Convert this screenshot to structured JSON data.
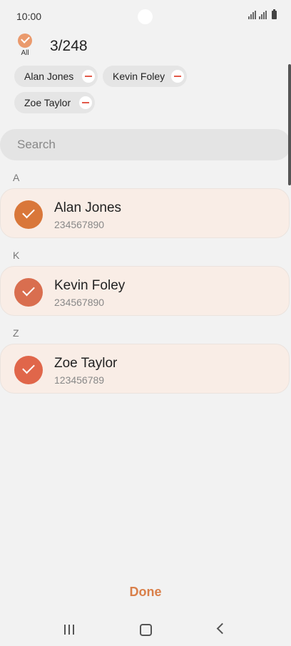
{
  "status_bar": {
    "time": "10:00"
  },
  "header": {
    "all_label": "All",
    "selection_count": "3/248"
  },
  "selected_chips": [
    {
      "label": "Alan Jones"
    },
    {
      "label": "Kevin Foley"
    },
    {
      "label": "Zoe Taylor"
    }
  ],
  "search": {
    "placeholder": "Search"
  },
  "sections": [
    {
      "letter": "A",
      "contact": {
        "name": "Alan Jones",
        "number": "234567890",
        "color": "#d9773a"
      }
    },
    {
      "letter": "K",
      "contact": {
        "name": "Kevin Foley",
        "number": "234567890",
        "color": "#d96e4f"
      }
    },
    {
      "letter": "Z",
      "contact": {
        "name": "Zoe Taylor",
        "number": "123456789",
        "color": "#e0664a"
      }
    }
  ],
  "footer": {
    "done_label": "Done"
  },
  "colors": {
    "accent": "#d97f49",
    "remove": "#e25a4a"
  }
}
